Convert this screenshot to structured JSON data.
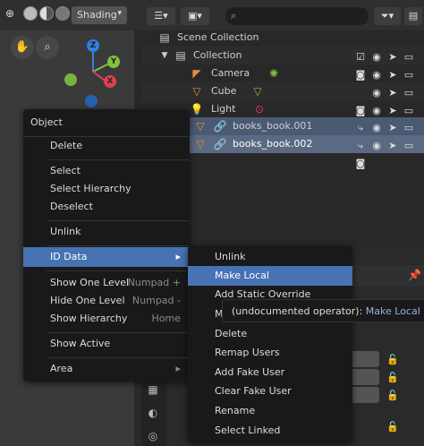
{
  "viewport": {
    "shading_label": "Shading",
    "gizmo": {
      "y": "Y",
      "x": "X",
      "z": "Z"
    }
  },
  "outliner": {
    "search_placeholder": "",
    "rows": [
      {
        "label": "Scene Collection"
      },
      {
        "label": "Collection"
      },
      {
        "label": "Camera"
      },
      {
        "label": "Cube"
      },
      {
        "label": "Light"
      },
      {
        "label": "books_book.001"
      },
      {
        "label": "books_book.002"
      }
    ]
  },
  "object_menu": {
    "title": "Object",
    "items": [
      {
        "label": "Delete",
        "shortcut": ""
      },
      {
        "label": "Select",
        "shortcut": ""
      },
      {
        "label": "Select Hierarchy",
        "shortcut": ""
      },
      {
        "label": "Deselect",
        "shortcut": ""
      },
      {
        "label": "Unlink",
        "shortcut": ""
      },
      {
        "label": "ID Data",
        "shortcut": "▸"
      },
      {
        "label": "Show One Level",
        "shortcut": "Numpad +"
      },
      {
        "label": "Hide One Level",
        "shortcut": "Numpad -"
      },
      {
        "label": "Show Hierarchy",
        "shortcut": "Home"
      },
      {
        "label": "Show Active",
        "shortcut": ""
      },
      {
        "label": "Area",
        "shortcut": "▸"
      }
    ]
  },
  "id_data_menu": {
    "items": [
      {
        "label": "Unlink"
      },
      {
        "label": "Make Local"
      },
      {
        "label": "Add Static Override"
      },
      {
        "label": "M"
      },
      {
        "label": "Delete"
      },
      {
        "label": "Remap Users"
      },
      {
        "label": "Add Fake User"
      },
      {
        "label": "Clear Fake User"
      },
      {
        "label": "Rename"
      },
      {
        "label": "Select Linked"
      }
    ]
  },
  "tooltip": {
    "text": "(undocumented operator): ",
    "op_name": "Make Local"
  },
  "colors": {
    "highlight": "#4772b3",
    "selected_row": "#4a5a72",
    "object_orange": "#e09040",
    "gizmo_x": "#e04050",
    "gizmo_y": "#80c040",
    "gizmo_z": "#3080e0"
  }
}
